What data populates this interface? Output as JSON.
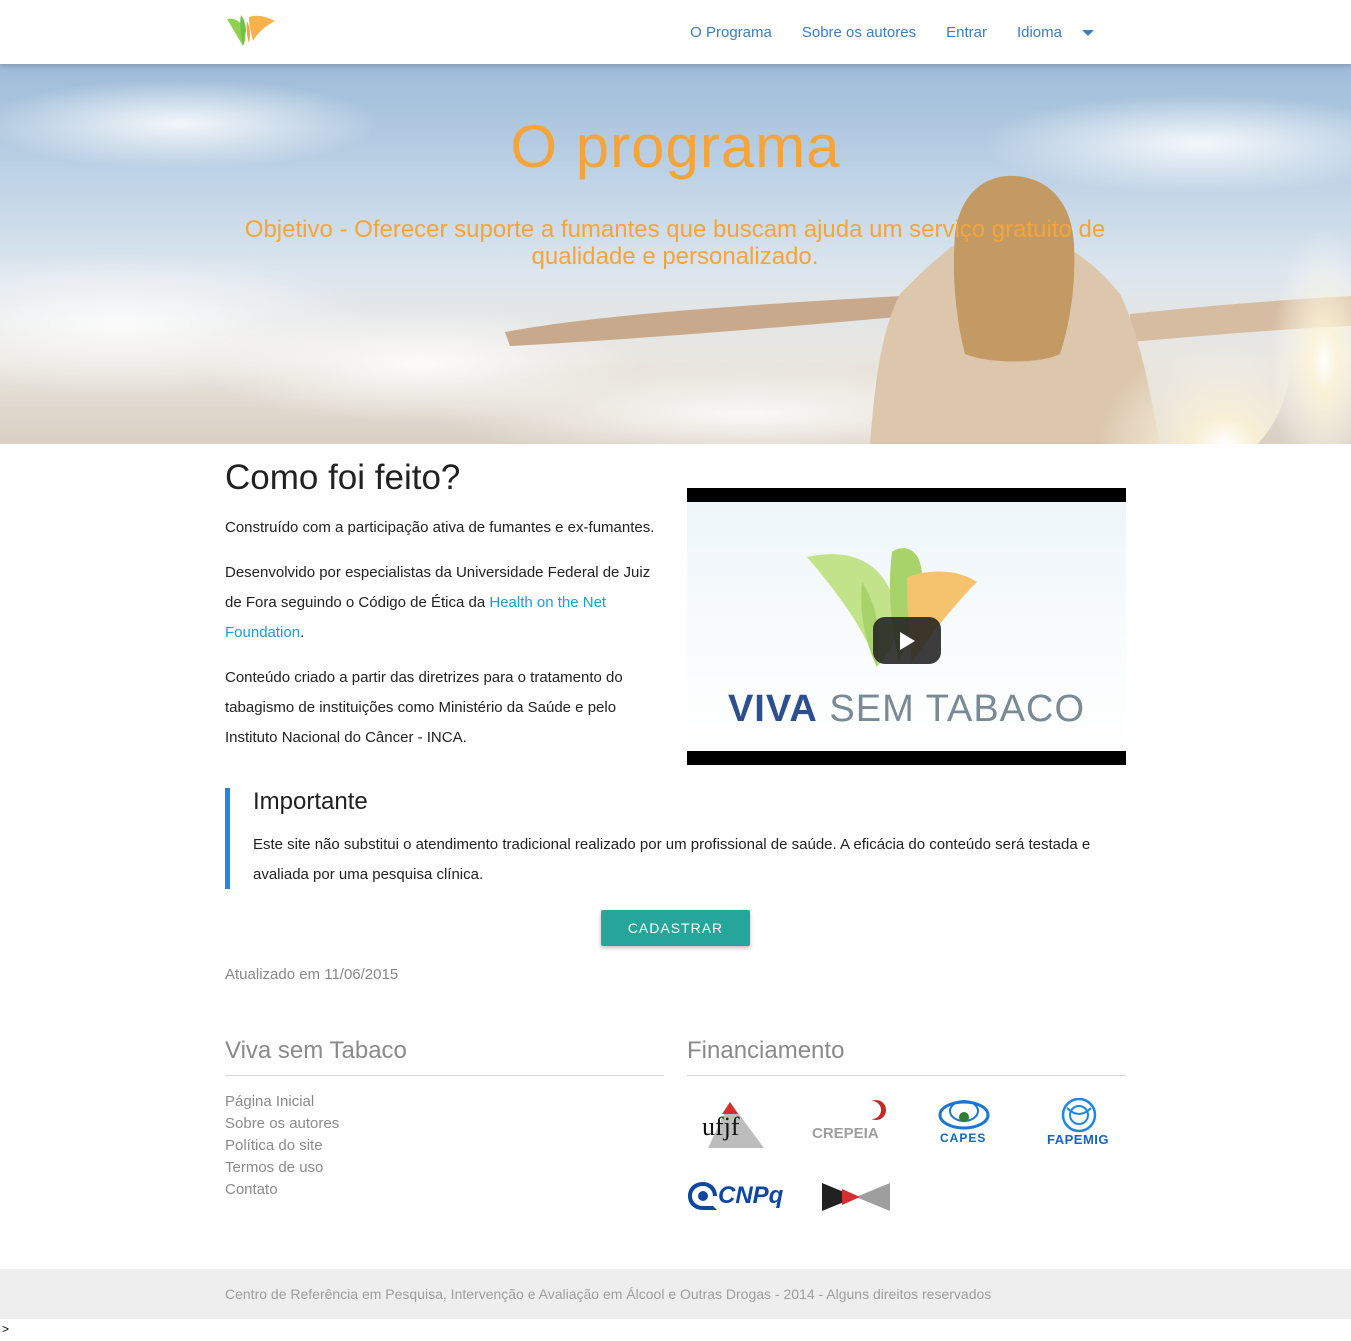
{
  "nav": {
    "links": [
      "O Programa",
      "Sobre os autores",
      "Entrar",
      "Idioma"
    ]
  },
  "hero": {
    "title": "O programa",
    "subtitle": "Objetivo - Oferecer suporte a fumantes que buscam ajuda um serviço gratuito de qualidade e personalizado."
  },
  "main": {
    "title": "Como foi feito?",
    "p1": "Construído com a participação ativa de fumantes e ex-fumantes.",
    "p2_before": "Desenvolvido por especialistas da Universidade Federal de Juiz de Fora seguindo o Código de Ética da ",
    "p2_link": "Health on the Net Foundation",
    "p2_after": ".",
    "p3": "Conteúdo criado a partir das diretrizes para o tratamento do tabagismo de instituições como Ministério da Saúde e pelo Instituto Nacional do Câncer - INCA."
  },
  "video": {
    "brand_bold": "VIVA",
    "brand_rest": " SEM TABACO"
  },
  "important": {
    "title": "Importante",
    "text": "Este site não substitui o atendimento tradicional realizado por um profissional de saúde. A eficácia do conteúdo será testada e avaliada por uma pesquisa clínica."
  },
  "cta": {
    "label": "CADASTRAR"
  },
  "updated": "Atualizado em 11/06/2015",
  "footer": {
    "left_title": "Viva sem Tabaco",
    "links": [
      "Página Inicial",
      "Sobre os autores",
      "Política do site",
      "Termos de uso",
      "Contato"
    ],
    "right_title": "Financiamento",
    "sponsors": [
      "ufjf",
      "CREPEIA",
      "CAPES",
      "FAPEMIG",
      "CNPq"
    ]
  },
  "bottom": "Centro de Referência em Pesquisa, Intervenção e Avaliação em Álcool e Outras Drogas - 2014 - Alguns direitos reservados",
  "stray": ">",
  "colors": {
    "accent_orange": "#f5a43a",
    "link_blue": "#1e9ad6",
    "nav_blue": "#3d7ebf",
    "button_teal": "#26a69a",
    "important_border": "#1e88e5"
  }
}
